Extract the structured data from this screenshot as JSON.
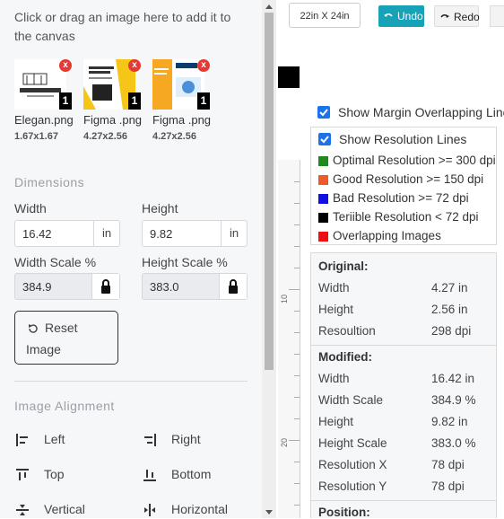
{
  "upload_hint": "Click or drag an image here to add it to the canvas",
  "images": [
    {
      "name": "Elegan.png",
      "size": "1.67x1.67",
      "count": "1",
      "remove": "x"
    },
    {
      "name": "Figma .png",
      "size": "4.27x2.56",
      "count": "1",
      "remove": "x"
    },
    {
      "name": "Figma .png",
      "size": "4.27x2.56",
      "count": "1",
      "remove": "x"
    }
  ],
  "dimensions": {
    "title": "Dimensions",
    "width_label": "Width",
    "width_value": "16.42",
    "width_unit": "in",
    "height_label": "Height",
    "height_value": "9.82",
    "height_unit": "in",
    "width_scale_label": "Width Scale %",
    "width_scale_value": "384.9",
    "height_scale_label": "Height Scale %",
    "height_scale_value": "383.0",
    "reset_label_1": "Reset",
    "reset_label_2": "Image"
  },
  "alignment": {
    "title": "Image Alignment",
    "left": "Left",
    "right": "Right",
    "top": "Top",
    "bottom": "Bottom",
    "vertical": "Vertical",
    "horizontal": "Horizontal"
  },
  "toolbar": {
    "canvas_size": "22in X 24in",
    "undo": "Undo",
    "redo": "Redo"
  },
  "ruler": {
    "mark_10": "10",
    "mark_20": "20"
  },
  "options": {
    "margin_lines": "Show Margin Overlapping Lines",
    "resolution_lines": "Show Resolution Lines"
  },
  "legend": [
    {
      "label": "Optimal Resolution >= 300 dpi",
      "color": "#1e8a1e"
    },
    {
      "label": "Good Resolution >= 150 dpi",
      "color": "#f05a28"
    },
    {
      "label": "Bad Resolution >= 72 dpi",
      "color": "#1010e0"
    },
    {
      "label": "Teriible Resolution < 72 dpi",
      "color": "#000000"
    },
    {
      "label": "Overlapping Images",
      "color": "#ee1111"
    }
  ],
  "info": {
    "original_title": "Original:",
    "original": [
      {
        "k": "Width",
        "v": "4.27 in"
      },
      {
        "k": "Height",
        "v": "2.56 in"
      },
      {
        "k": "Resoultion",
        "v": "298 dpi"
      }
    ],
    "modified_title": "Modified:",
    "modified": [
      {
        "k": "Width",
        "v": "16.42 in"
      },
      {
        "k": "Width Scale",
        "v": "384.9 %"
      },
      {
        "k": "Height",
        "v": "9.82 in"
      },
      {
        "k": "Height Scale",
        "v": "383.0 %"
      },
      {
        "k": "Resolution X",
        "v": "78 dpi"
      },
      {
        "k": "Resolution Y",
        "v": "78 dpi"
      }
    ],
    "position_title": "Position:"
  },
  "colors": {
    "accent": "#17a2b8",
    "checkbox": "#1a73e8",
    "remove": "#e53935"
  }
}
